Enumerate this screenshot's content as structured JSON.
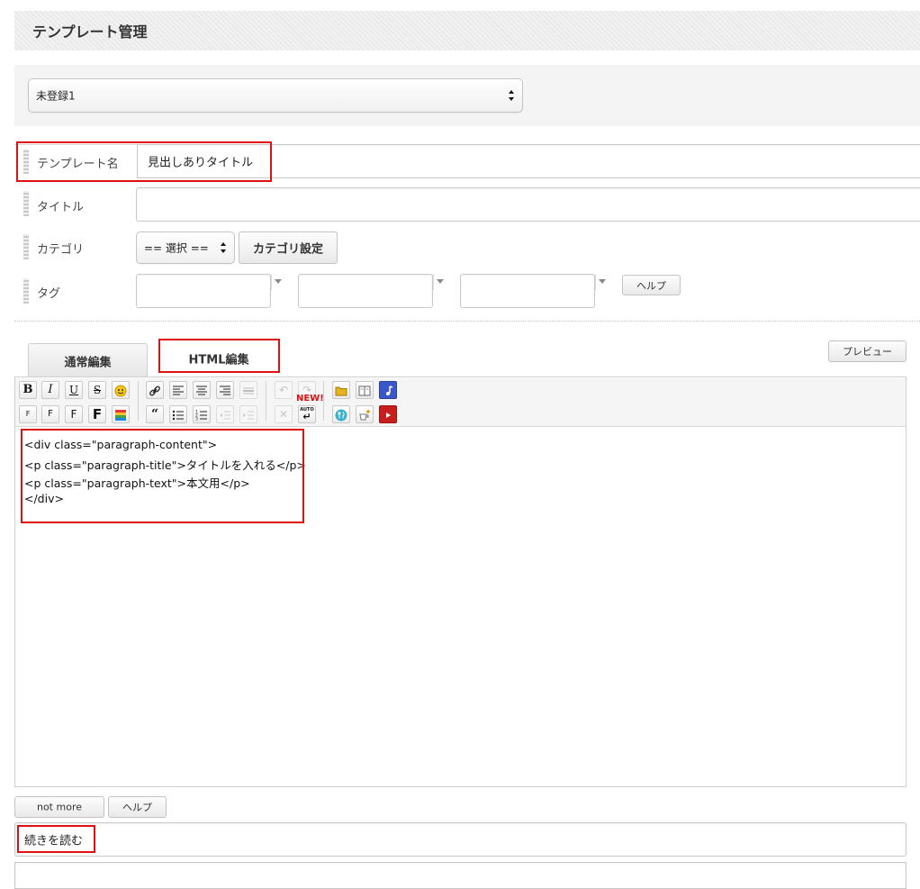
{
  "header": {
    "title": "テンプレート管理"
  },
  "template_select": {
    "value": "未登録1"
  },
  "form": {
    "template_name": {
      "label": "テンプレート名",
      "value": "見出しありタイトル"
    },
    "title": {
      "label": "タイトル",
      "value": ""
    },
    "category": {
      "label": "カテゴリ",
      "select_value": "== 選択 ==",
      "settings_button": "カテゴリ設定"
    },
    "tags": {
      "label": "タグ",
      "inputs": [
        "",
        "",
        ""
      ],
      "help_button": "ヘルプ"
    }
  },
  "tabs": [
    {
      "label": "通常編集",
      "active": false
    },
    {
      "label": "HTML編集",
      "active": true
    }
  ],
  "preview_button": "プレビュー",
  "toolbar": {
    "row1": [
      "bold-button",
      "italic-button",
      "underline-button",
      "strikethrough-button",
      "emoji-button",
      "link-button",
      "align-left-button",
      "align-center-button",
      "align-right-button",
      "horizontal-rule-button",
      "undo-button",
      "redo-button",
      "folder-button",
      "book-button",
      "music-button"
    ],
    "row2": [
      "font-size-small-button",
      "font-size-medium-button",
      "font-size-large-button",
      "font-size-xlarge-button",
      "color-button",
      "quote-button",
      "bullet-list-button",
      "numbered-list-button",
      "outdent-button",
      "indent-button",
      "remove-format-button",
      "auto-button",
      "recipe-button",
      "add-item-button",
      "video-button"
    ],
    "new_badge": "NEW!",
    "auto_label": "AUTO"
  },
  "editor": {
    "lines": [
      "<div class=\"paragraph-content\">",
      "<p class=\"paragraph-title\">タイトルを入れる</p>",
      "<p class=\"paragraph-text\">本文用</p>",
      "</div>"
    ]
  },
  "more": {
    "not_more_button": "not more",
    "help_button": "ヘルプ",
    "text": "続きを読む"
  },
  "colors": {
    "highlight": "#dd1111",
    "header_bg": "#e9e9e9"
  }
}
